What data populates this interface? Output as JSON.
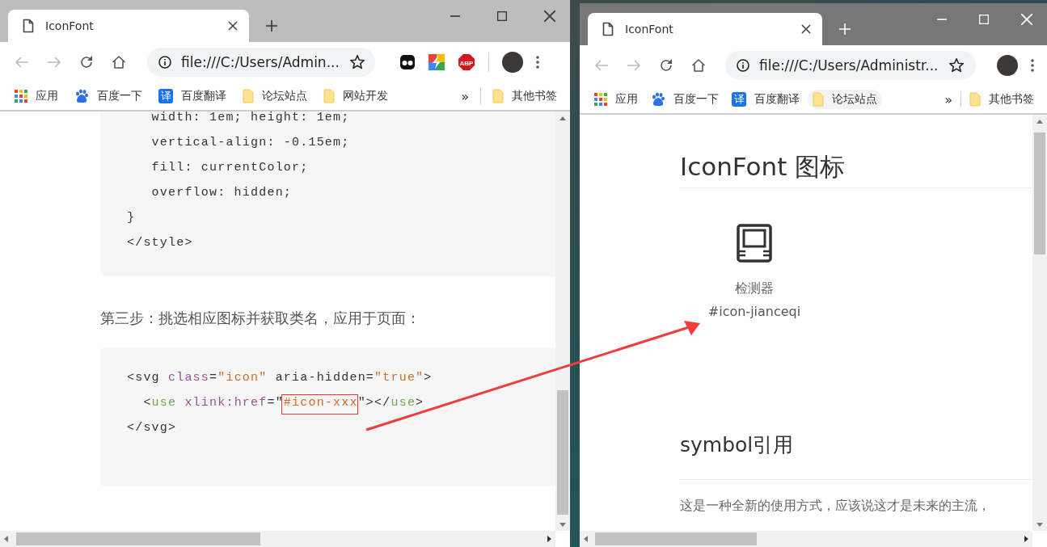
{
  "windows": [
    {
      "active": false,
      "tab": {
        "title": "IconFont",
        "selected": true
      },
      "address": "file:///C:/Users/Admin...",
      "extensions": [
        {
          "kind": "ghost"
        },
        {
          "kind": "bolt"
        },
        {
          "kind": "abp",
          "label": "ABP"
        }
      ],
      "bookmarks": [
        {
          "kind": "apps",
          "label": "应用",
          "hovered": false
        },
        {
          "kind": "paw",
          "label": "百度一下",
          "hovered": false
        },
        {
          "kind": "translate",
          "glyph": "译",
          "label": "百度翻译",
          "hovered": false
        },
        {
          "kind": "folder",
          "label": "论坛站点",
          "hovered": false
        },
        {
          "kind": "folder",
          "label": "网站开发",
          "hovered": false
        }
      ],
      "more": "»",
      "other_bookmarks": {
        "kind": "folder",
        "label": "其他书签"
      },
      "page": [
        {
          "kind": "code",
          "lines": [
            [
              {
                "kind": "plain",
                "text": "   width: 1em; height: 1em;"
              }
            ],
            [
              {
                "kind": "plain",
                "text": "   vertical-align: -0.15em;"
              }
            ],
            [
              {
                "kind": "plain",
                "text": "   fill: currentColor;"
              }
            ],
            [
              {
                "kind": "plain",
                "text": "   overflow: hidden;"
              }
            ],
            [
              {
                "kind": "plain",
                "text": "}"
              }
            ],
            [
              {
                "kind": "plain",
                "text": "</style>"
              }
            ]
          ]
        },
        {
          "kind": "paragraph",
          "text": "第三步：挑选相应图标并获取类名，应用于页面："
        },
        {
          "kind": "code",
          "lines": [
            [
              {
                "kind": "plain",
                "text": "<svg "
              },
              {
                "kind": "attr",
                "text": "class"
              },
              {
                "kind": "plain",
                "text": "="
              },
              {
                "kind": "string",
                "text": "\"icon\""
              },
              {
                "kind": "plain",
                "text": " aria-hidden="
              },
              {
                "kind": "string",
                "text": "\"true\""
              },
              {
                "kind": "plain",
                "text": ">"
              }
            ],
            [
              {
                "kind": "plain",
                "text": "  <"
              },
              {
                "kind": "tag",
                "text": "use"
              },
              {
                "kind": "attr",
                "text": " xlink:href"
              },
              {
                "kind": "plain",
                "text": "=\""
              },
              {
                "kind": "string",
                "text": "#icon-xxx",
                "boxed": true
              },
              {
                "kind": "plain",
                "text": "\"></"
              },
              {
                "kind": "tag",
                "text": "use"
              },
              {
                "kind": "plain",
                "text": ">"
              }
            ],
            [
              {
                "kind": "plain",
                "text": "</svg>"
              }
            ]
          ]
        }
      ]
    },
    {
      "active": true,
      "tab": {
        "title": "IconFont",
        "selected": true
      },
      "address": "file:///C:/Users/Administr...",
      "bookmarks": [
        {
          "kind": "apps",
          "label": "应用",
          "hovered": false
        },
        {
          "kind": "paw",
          "label": "百度一下",
          "hovered": false
        },
        {
          "kind": "translate",
          "glyph": "译",
          "label": "百度翻译",
          "hovered": false
        },
        {
          "kind": "folder",
          "label": "论坛站点",
          "hovered": true
        }
      ],
      "more": "»",
      "other_bookmarks": {
        "kind": "folder",
        "label": "其他书签"
      },
      "page": [
        {
          "kind": "heading",
          "text": "IconFont 图标"
        },
        {
          "kind": "icon_card",
          "name": "检测器",
          "code": "#icon-jianceqi"
        },
        {
          "kind": "subheading",
          "text": "symbol引用"
        },
        {
          "kind": "paragraph",
          "text": "这是一种全新的使用方式，应该说这才是未来的主流，"
        }
      ]
    }
  ],
  "annotation": {
    "arrow": true
  }
}
